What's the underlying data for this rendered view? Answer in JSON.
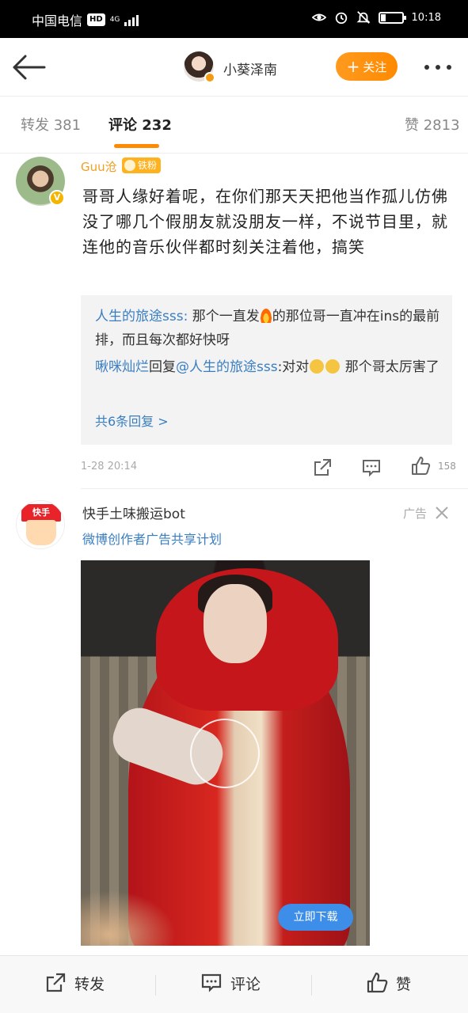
{
  "status_bar": {
    "carrier": "中国电信",
    "hd": "HD",
    "network": "4G",
    "time": "10:18"
  },
  "header": {
    "name": "小葵泽南",
    "follow_label": "关注"
  },
  "tabs": [
    {
      "label": "转发 381"
    },
    {
      "label": "评论 232"
    },
    {
      "label": "赞 2813"
    }
  ],
  "comment": {
    "username": "Guu沧",
    "badge": "铁粉",
    "text": "哥哥人缘好着呢，在你们那天天把他当作孤儿仿佛没了哪几个假朋友就没朋友一样，不说节目里，就连他的音乐伙伴都时刻关注着他，搞笑",
    "replies": [
      {
        "user": "人生的旅途sss:",
        "text_a": " 那个一直发",
        "text_b": "的那位哥一直冲在ins的最前排，而且每次都好快呀"
      },
      {
        "user": "啾咪灿烂",
        "mid": "回复",
        "mention": "@人生的旅途sss",
        "text": ":对对",
        "text_b": " 那个哥太厉害了"
      }
    ],
    "more_replies": "共6条回复 >",
    "time": "1-28 20:14",
    "like_count": "158"
  },
  "ad": {
    "avatar_text": "快手",
    "name": "快手土味搬运bot",
    "label": "广告",
    "subtitle": "微博创作者广告共享计划",
    "download_label": "立即下载"
  },
  "bottom_bar": {
    "repost": "转发",
    "comment": "评论",
    "like": "赞"
  },
  "colors": {
    "accent_orange": "#ff8a00",
    "link_blue": "#3a7ec2"
  }
}
